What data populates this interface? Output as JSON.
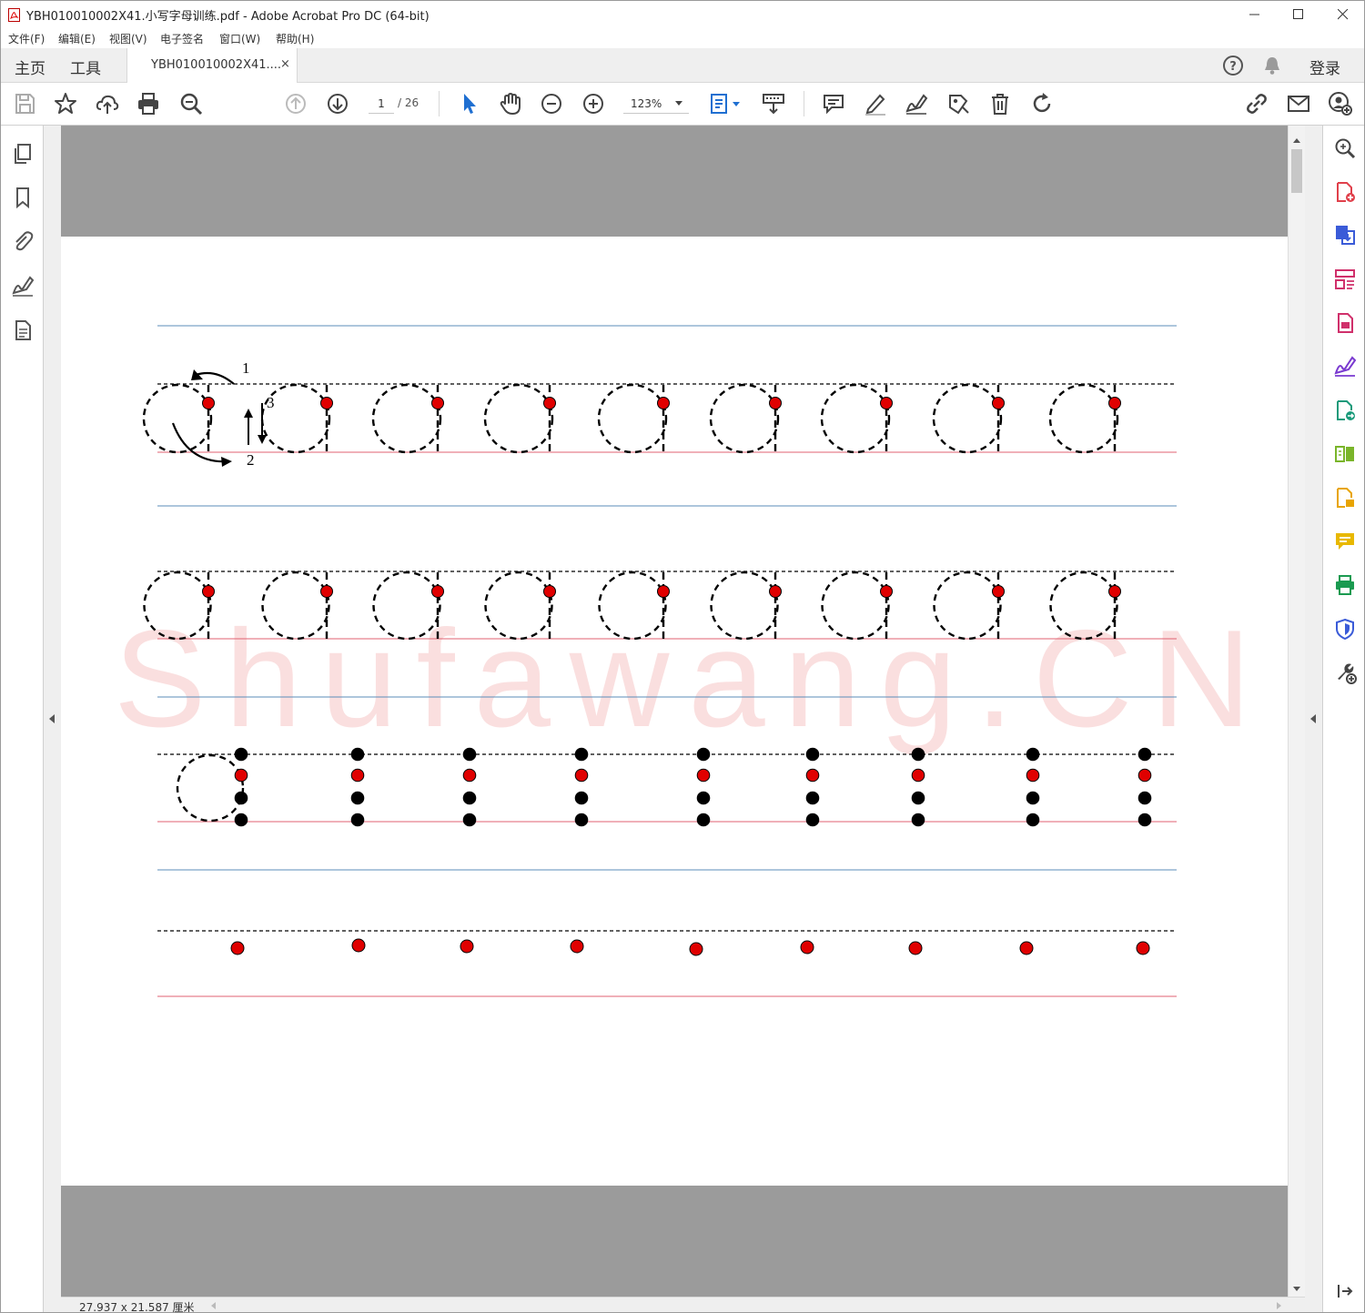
{
  "window": {
    "title": "YBH010010002X41.小写字母训练.pdf - Adobe Acrobat Pro DC (64-bit)",
    "icon": "acrobat-pdf-icon",
    "controls": [
      "minimize-icon",
      "maximize-icon",
      "close-icon"
    ]
  },
  "menu": {
    "file": "文件(F)",
    "edit": "编辑(E)",
    "view": "视图(V)",
    "esign": "电子签名",
    "window": "窗口(W)",
    "help": "帮助(H)"
  },
  "tabs": {
    "home": "主页",
    "tools": "工具",
    "document": "YBH010010002X41....",
    "document_close": "×",
    "sign_in": "登录"
  },
  "toolbar": {
    "page_current": "1",
    "page_total": "/ 26",
    "zoom": "123%",
    "icons": [
      "save-icon",
      "star-icon",
      "cloud-upload-icon",
      "print-icon",
      "search-icon",
      "page-up-icon",
      "page-down-icon",
      "select-cursor-icon",
      "hand-icon",
      "zoom-out-icon",
      "zoom-in-icon",
      "page-display-icon",
      "read-aloud-icon",
      "comment-icon",
      "highlight-icon",
      "sign-icon",
      "stamp-icon",
      "delete-icon",
      "rotate-icon",
      "share-link-icon",
      "email-icon",
      "add-user-icon"
    ]
  },
  "left_pane": [
    "pages-icon",
    "bookmark-icon",
    "attachment-icon",
    "signature-icon",
    "layers-icon"
  ],
  "right_pane": [
    "enhance-scan-icon",
    "create-pdf-icon",
    "export-pdf-icon",
    "organize-pages-icon",
    "compress-pdf-icon",
    "fill-sign-icon",
    "combine-files-icon",
    "compare-icon",
    "edit-pdf-icon",
    "comment-icon",
    "print-production-icon",
    "protect-icon",
    "more-tools-icon"
  ],
  "worksheet": {
    "stroke_numbers": [
      "1",
      "2",
      "3"
    ],
    "letter": "a",
    "colors": {
      "top_guide": "#5b8db8",
      "base_guide": "#e06070",
      "start_dot": "#e00000",
      "trace_dot": "#000000",
      "watermark": "#f4b8b8"
    }
  },
  "watermark": "Shufawang.CN",
  "status": {
    "page_size": "27.937 x 21.587 厘米"
  }
}
